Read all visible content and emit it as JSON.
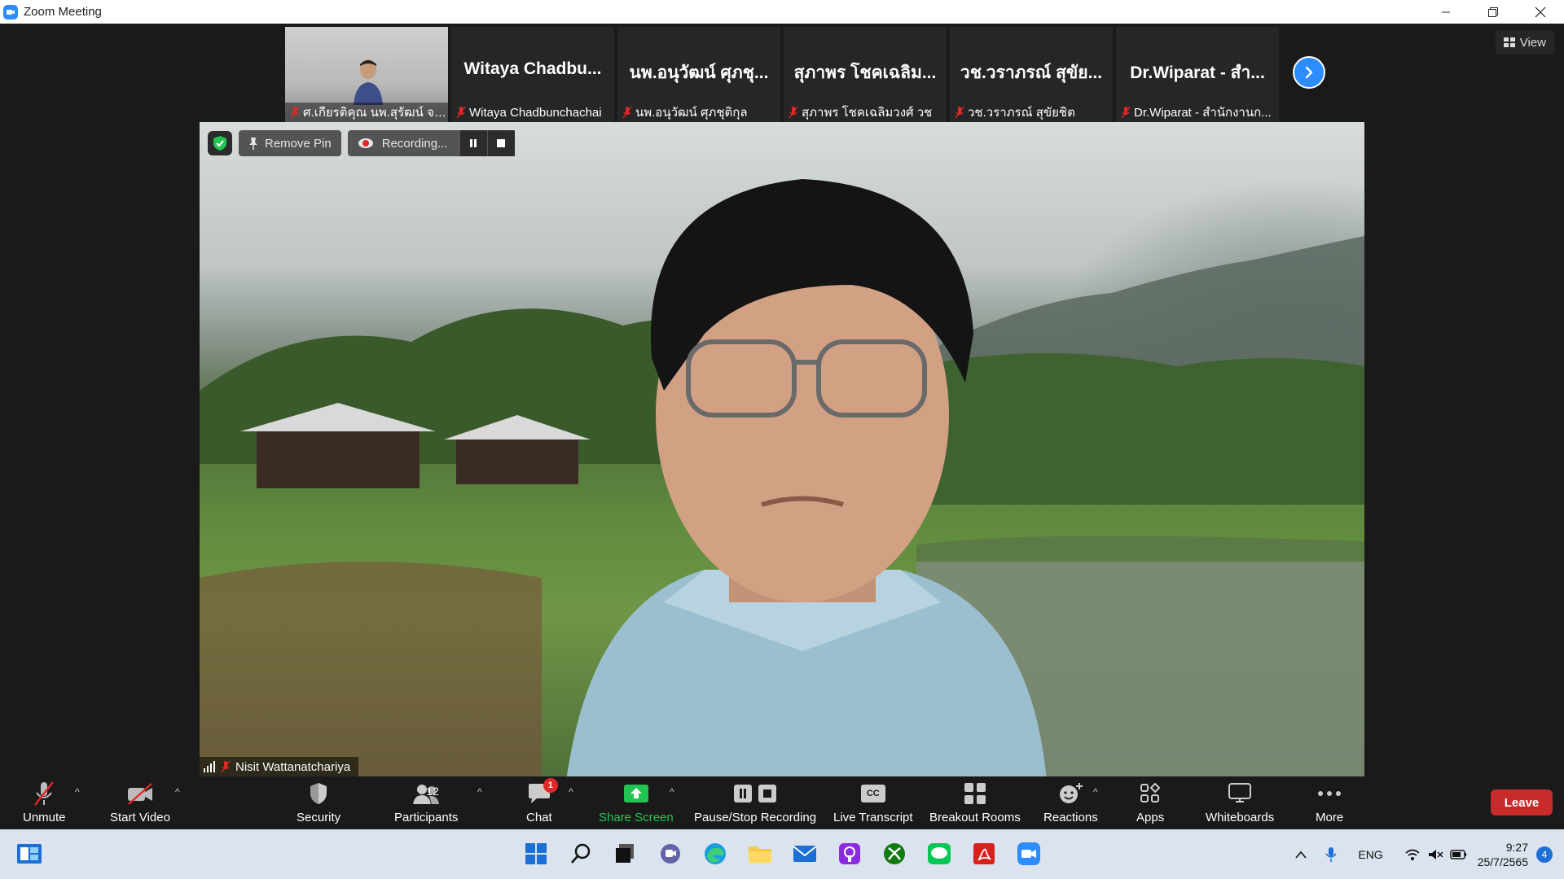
{
  "window": {
    "title": "Zoom Meeting"
  },
  "gallery": {
    "self_tile_name": "ศ.เกียรติคุณ นพ.สุรัฒน์ จริ...",
    "tiles": [
      {
        "big": "Witaya  Chadbu...",
        "small": "Witaya Chadbunchachai"
      },
      {
        "big": "นพ.อนุวัฒน์ ศุภชุ...",
        "small": "นพ.อนุวัฒน์ ศุภชุติกุล"
      },
      {
        "big": "สุภาพร โชคเฉลิม...",
        "small": "สุภาพร โชคเฉลิมวงศ์ วช"
      },
      {
        "big": "วช.วราภรณ์ สุขัย...",
        "small": "วช.วราภรณ์ สุขัยชิต"
      },
      {
        "big": "Dr.Wiparat - สำ...",
        "small": "Dr.Wiparat - สำนักงานก..."
      }
    ],
    "view_label": "View"
  },
  "main_video": {
    "remove_pin_label": "Remove Pin",
    "recording_label": "Recording...",
    "speaker_name": "Nisit Wattanatchariya"
  },
  "toolbar": {
    "unmute": "Unmute",
    "start_video": "Start Video",
    "security": "Security",
    "participants": "Participants",
    "participants_count": "12",
    "chat": "Chat",
    "chat_badge": "1",
    "share_screen": "Share Screen",
    "pause_stop_recording": "Pause/Stop Recording",
    "live_transcript": "Live Transcript",
    "cc_label": "CC",
    "breakout_rooms": "Breakout Rooms",
    "reactions": "Reactions",
    "apps": "Apps",
    "whiteboards": "Whiteboards",
    "more": "More",
    "leave": "Leave"
  },
  "taskbar": {
    "language": "ENG",
    "time": "9:27",
    "date": "25/7/2565",
    "notifications": "4"
  },
  "colors": {
    "zoom_blue": "#2d8cff",
    "leave_red": "#c92a2a",
    "share_green": "#23c552",
    "mute_red": "#e02828"
  }
}
